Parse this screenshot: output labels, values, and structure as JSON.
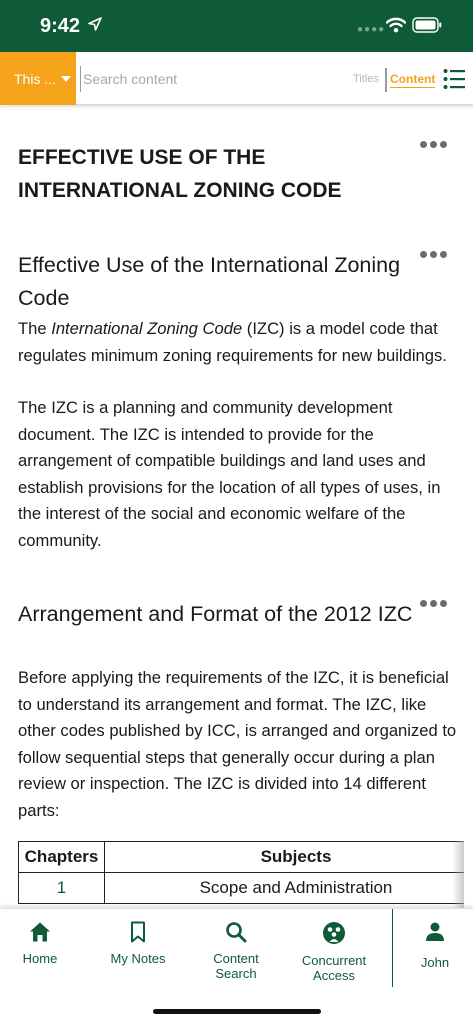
{
  "status_bar": {
    "time": "9:42",
    "icons": [
      "location-arrow-icon",
      "cellular-dots-icon",
      "wifi-icon",
      "battery-icon"
    ]
  },
  "search_bar": {
    "scope_label": "This ...",
    "placeholder": "Search content",
    "mode_titles": "Titles",
    "mode_content": "Content",
    "accent_color": "#f5a31a"
  },
  "document": {
    "main_title": "EFFECTIVE USE OF THE INTERNATIONAL ZONING CODE",
    "sections": [
      {
        "title": "Effective Use of the International Zoning Code",
        "p1_prefix": "The ",
        "p1_italic": "International Zoning Code",
        "p1_suffix": " (IZC) is a model code that regulates minimum zoning requirements for new buildings.",
        "p2": "The IZC is a planning and community development document. The IZC is intended to provide for the arrangement of compatible buildings and land uses and establish provisions for the location of all types of uses, in the interest of the social and economic welfare of the community."
      },
      {
        "title": "Arrangement and Format of the 2012 IZC",
        "p1": "Before applying the requirements of the IZC, it is beneficial to understand its arrangement and format. The IZC, like other codes published by ICC, is arranged and organized to follow sequential steps that generally occur during a plan review or inspection. The IZC is divided into 14 different parts:"
      }
    ],
    "table": {
      "headers": [
        "Chapters",
        "Subjects"
      ],
      "rows": [
        [
          "1",
          "Scope and Administration"
        ]
      ]
    }
  },
  "tab_bar": {
    "brand_color": "#0f5a37",
    "tabs": [
      {
        "label": "Home",
        "icon": "home-icon"
      },
      {
        "label": "My Notes",
        "icon": "bookmark-icon"
      },
      {
        "label": "Content Search",
        "icon": "search-icon"
      },
      {
        "label": "Concurrent Access",
        "icon": "concurrent-access-icon"
      },
      {
        "label": "John",
        "icon": "user-icon"
      }
    ]
  }
}
